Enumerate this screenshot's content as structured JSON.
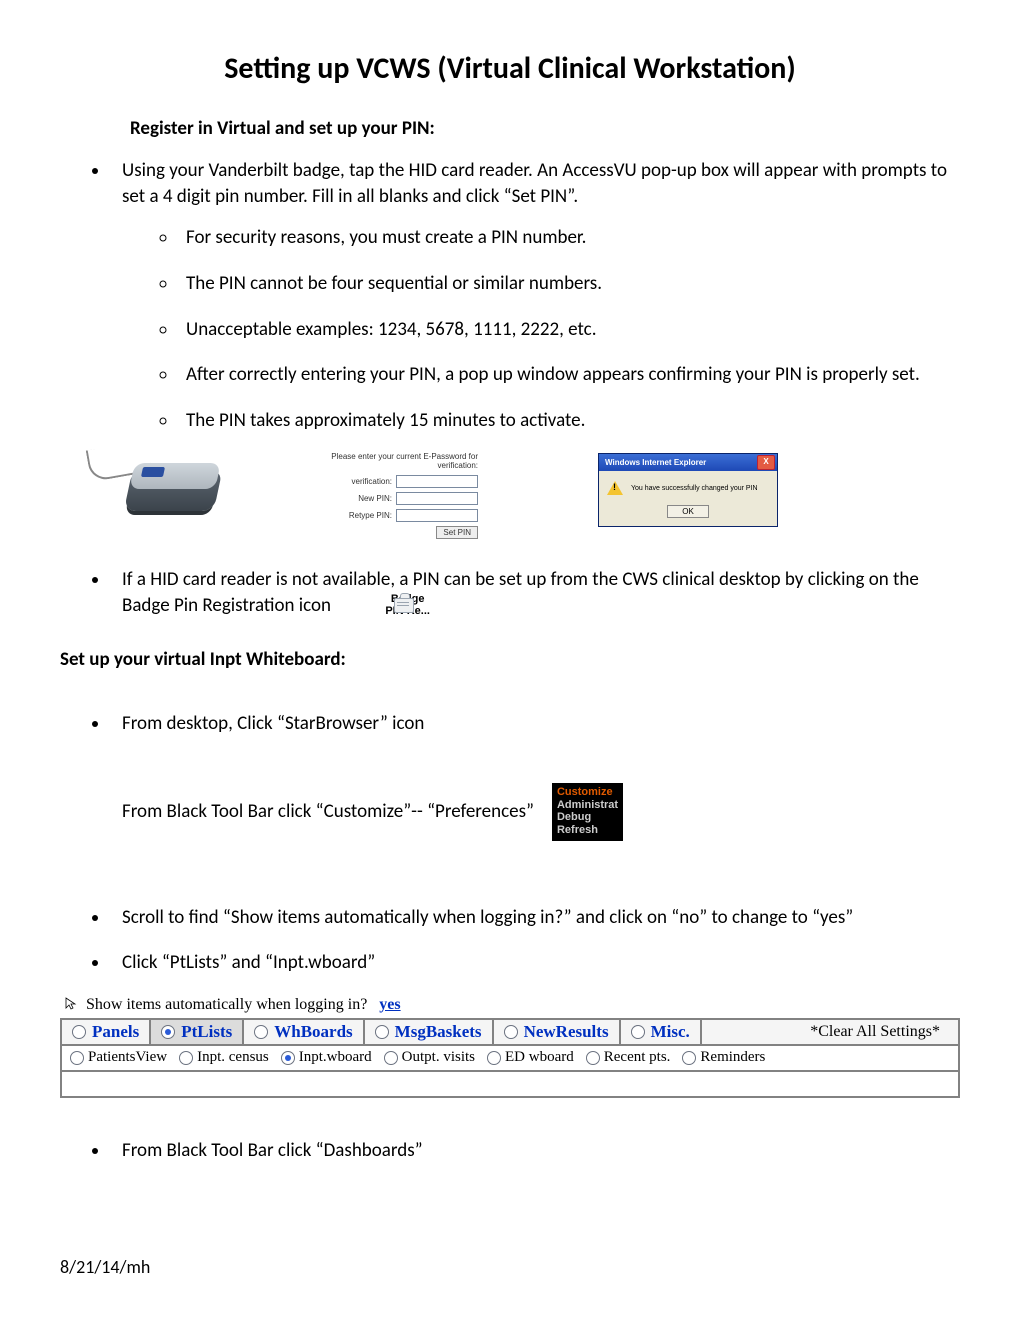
{
  "title": "Setting up VCWS (Virtual Clinical Workstation)",
  "section1_head": "Register in Virtual and set up your PIN:",
  "b1": "Using your Vanderbilt badge, tap the HID card reader.  An AccessVU pop-up box will appear with prompts to set a 4 digit pin number.  Fill in all blanks and click “Set PIN”.",
  "b1a": "For security reasons, you must create a PIN number.",
  "b1b": "The PIN cannot be four sequential or similar numbers.",
  "b1c": "Unacceptable examples: 1234, 5678, 1111, 2222, etc.",
  "b1d": "After correctly entering your PIN, a pop up window appears confirming your PIN is properly set.",
  "b1e": "The PIN takes approximately 15 minutes to activate.",
  "pinform": {
    "hdr": "Please enter your current E-Password for verification:",
    "l2": "New PIN:",
    "l3": "Retype PIN:",
    "btn": "Set PIN"
  },
  "iedlg": {
    "title": "Windows Internet Explorer",
    "msg": "You have successfully changed your PIN",
    "ok": "OK"
  },
  "b2_pre": "If a HID card reader is not available, a PIN can be set up from the CWS clinical desktop by clicking on the Badge Pin Registration icon",
  "badge_icon": {
    "l1": "Badge",
    "l2": "PIN Re..."
  },
  "section2_head": "Set up your virtual Inpt Whiteboard:",
  "s2_b1": "From desktop, Click “StarBrowser” icon",
  "s2_b2": "From Black Tool Bar click “Customize”-- “Preferences”",
  "blktool": {
    "r1": "Customize",
    "r2": "Administrat",
    "r3": "Debug",
    "r4": "Refresh"
  },
  "s2_b3": "Scroll to find “Show items automatically when logging in?” and click on “no” to change to “yes”",
  "s2_b4": "Click “PtLists” and “Inpt.wboard”",
  "prefs": {
    "question": "Show items automatically when logging in?",
    "yes": "yes",
    "tabs": {
      "panels": "Panels",
      "ptlists": "PtLists",
      "whboards": "WhBoards",
      "msgbaskets": "MsgBaskets",
      "newresults": "NewResults",
      "misc": "Misc."
    },
    "clear": "*Clear All Settings*",
    "sub": {
      "pv": "PatientsView",
      "census": "Inpt. census",
      "wboard": "Inpt.wboard",
      "outpt": "Outpt. visits",
      "ed": "ED wboard",
      "recent": "Recent pts.",
      "rem": "Reminders"
    }
  },
  "s2_b5": "From Black Tool Bar click  “Dashboards”",
  "footer": "8/21/14/mh"
}
